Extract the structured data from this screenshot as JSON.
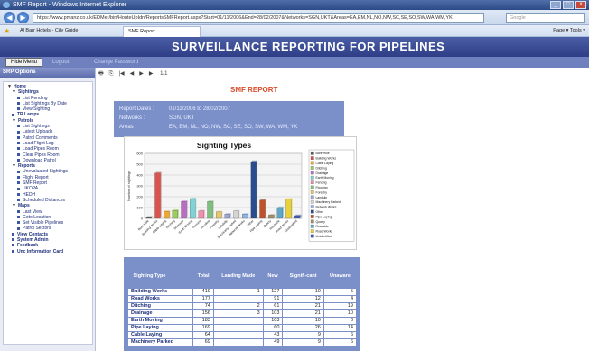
{
  "browser": {
    "window_title": "SMF Report - Windows Internet Explorer",
    "url": "https://www.pmanz.co.uk/EDMer/bin/HouteUpIdn/ReportsSMFReport.aspx?Start=01/11/2006&End=28/02/2007&Networks=SGN,UKT&Areas=EA,EM,NL,NO,NW,SC,SE,SO,SW,WA,WM,YK",
    "search_placeholder": "Google",
    "favorites_label": "Al Barr Hotels - City Guide",
    "tab_label": "SMF Report",
    "tools_label": "Page ▾   Tools ▾"
  },
  "app": {
    "header_title": "SURVEILLANCE REPORTING FOR PIPELINES",
    "hide_menu_label": "Hide Menu",
    "logout_label": "Logout",
    "change_password_label": "Change Password"
  },
  "sidebar": {
    "heading": "SRP Options",
    "items": [
      {
        "label": "Home",
        "level": "l0",
        "kind": "caret"
      },
      {
        "label": "Sightings",
        "level": "l1",
        "kind": "caret"
      },
      {
        "label": "List Pending",
        "level": "l2",
        "kind": "bullet"
      },
      {
        "label": "List Sightings By Date",
        "level": "l2",
        "kind": "bullet"
      },
      {
        "label": "View Sighting",
        "level": "l2",
        "kind": "bullet"
      },
      {
        "label": "TR Lamps",
        "level": "l1",
        "kind": "bullet"
      },
      {
        "label": "Patrols",
        "level": "l1",
        "kind": "caret"
      },
      {
        "label": "List Sightings",
        "level": "l2",
        "kind": "bullet"
      },
      {
        "label": "Latest Uploads",
        "level": "l2",
        "kind": "bullet"
      },
      {
        "label": "Patrol Comments",
        "level": "l2",
        "kind": "bullet"
      },
      {
        "label": "Load Flight Log",
        "level": "l2",
        "kind": "bullet"
      },
      {
        "label": "Load Pipes Room",
        "level": "l2",
        "kind": "bullet"
      },
      {
        "label": "Clear Pipes Room",
        "level": "l2",
        "kind": "bullet"
      },
      {
        "label": "Download Patrol",
        "level": "l2",
        "kind": "bullet"
      },
      {
        "label": "Reports",
        "level": "l1",
        "kind": "caret"
      },
      {
        "label": "Unevaluated Sightings",
        "level": "l2",
        "kind": "bullet"
      },
      {
        "label": "Flight Report",
        "level": "l2",
        "kind": "bullet"
      },
      {
        "label": "SMF Report",
        "level": "l2",
        "kind": "bullet"
      },
      {
        "label": "UKOPA",
        "level": "l2",
        "kind": "bullet"
      },
      {
        "label": "HEDH",
        "level": "l2",
        "kind": "bullet"
      },
      {
        "label": "Scheduled Distances",
        "level": "l2",
        "kind": "bullet"
      },
      {
        "label": "Maps",
        "level": "l1",
        "kind": "caret"
      },
      {
        "label": "Last View",
        "level": "l2",
        "kind": "bullet"
      },
      {
        "label": "Goto Location",
        "level": "l2",
        "kind": "bullet"
      },
      {
        "label": "Set Visible Pipelines",
        "level": "l2",
        "kind": "bullet"
      },
      {
        "label": "Patrol Sectors",
        "level": "l2",
        "kind": "bullet"
      },
      {
        "label": "View Contacts",
        "level": "l1",
        "kind": "bullet"
      },
      {
        "label": "System Admin",
        "level": "l1",
        "kind": "bullet"
      },
      {
        "label": "Feedback",
        "level": "l1",
        "kind": "bullet"
      },
      {
        "label": "Unc Information Card",
        "level": "l1",
        "kind": "bullet"
      }
    ]
  },
  "report": {
    "toolbar_pager": "1/1",
    "title": "SMF REPORT",
    "filters": [
      {
        "key": "Report Dates :",
        "value": "01/11/2006 to 28/02/2007"
      },
      {
        "key": "Networks :",
        "value": "SGN, UKT"
      },
      {
        "key": "Areas :",
        "value": "EA, EM, NL, NO, NW, SC, SE, SO, SW, WA, WM, YK"
      }
    ],
    "table": {
      "headers": [
        "Sighting Type",
        "Total",
        "Landing Made",
        "New",
        "Signifi-cant",
        "Unaware"
      ],
      "rows": [
        [
          "Building Works",
          "419",
          "1",
          "127",
          "10",
          "5"
        ],
        [
          "Road Works",
          "177",
          "",
          "91",
          "12",
          "4"
        ],
        [
          "Ditching",
          "74",
          "2",
          "61",
          "21",
          "19"
        ],
        [
          "Drainage",
          "156",
          "3",
          "103",
          "21",
          "10"
        ],
        [
          "Earth Moving",
          "183",
          "",
          "103",
          "10",
          "6"
        ],
        [
          "Pipe Laying",
          "169",
          "",
          "60",
          "26",
          "14"
        ],
        [
          "Cable Laying",
          "64",
          "",
          "43",
          "9",
          "6"
        ],
        [
          "Machinery Parked",
          "69",
          "",
          "49",
          "9",
          "6"
        ]
      ]
    }
  },
  "chart_data": {
    "type": "bar",
    "title": "Sighting Types",
    "xlabel": "",
    "ylabel": "Number of sightings",
    "ylim": [
      0,
      600
    ],
    "yticks": [
      0,
      100,
      200,
      300,
      400,
      500,
      600
    ],
    "categories": [
      "Bore Hole",
      "Building Works",
      "Cable Laying",
      "Ditching",
      "Drainage",
      "Earth Moving",
      "Fencing",
      "Flooding",
      "Forestry",
      "Landslip",
      "Machinery Parked",
      "Network Works",
      "Other",
      "Pipe Laying",
      "Quarry",
      "Roadside",
      "Road Works",
      "Unidentified"
    ],
    "values": [
      10,
      419,
      64,
      74,
      156,
      183,
      69,
      155,
      60,
      40,
      69,
      40,
      525,
      169,
      30,
      100,
      177,
      25
    ],
    "colors": [
      "#5a5a5a",
      "#d9534f",
      "#f0a830",
      "#9acd5b",
      "#b86fc2",
      "#7fd3d6",
      "#f28fb0",
      "#7fbf7f",
      "#e6c76b",
      "#9aa7d8",
      "#d4d4d4",
      "#8fb3e6",
      "#2a4d8f",
      "#c0522b",
      "#a58f6a",
      "#5fa7c9",
      "#e8d23a",
      "#3d5bb8"
    ],
    "legend_position": "right",
    "grid": true
  }
}
